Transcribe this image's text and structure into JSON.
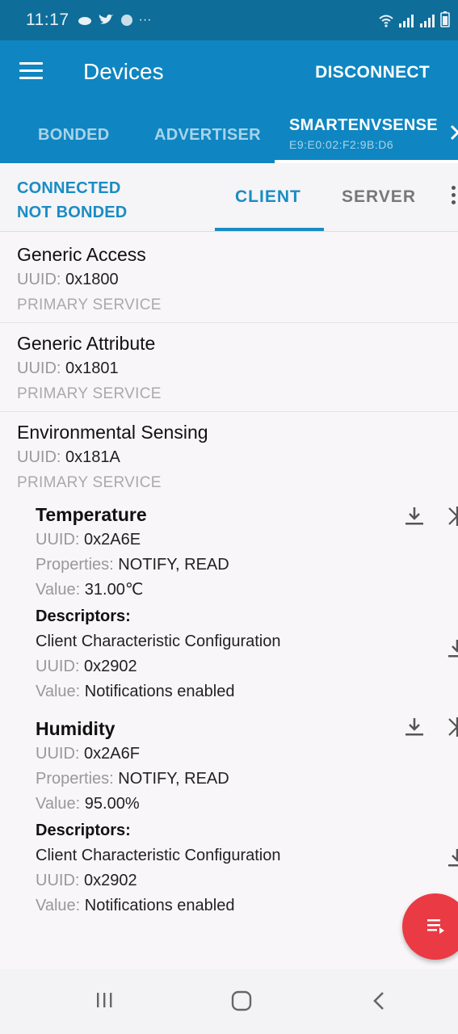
{
  "status_bar": {
    "time": "11:17",
    "more": "···"
  },
  "app_bar": {
    "title": "Devices",
    "action": "DISCONNECT"
  },
  "device_tabs": [
    {
      "label": "BONDED"
    },
    {
      "label": "ADVERTISER"
    },
    {
      "label": "SMARTENVSENSE",
      "address": "E9:E0:02:F2:9B:D6"
    }
  ],
  "connection": {
    "state": "CONNECTED",
    "bond": "NOT BONDED",
    "tabs": [
      "CLIENT",
      "SERVER"
    ]
  },
  "labels": {
    "uuid": "UUID:",
    "properties": "Properties:",
    "value": "Value:",
    "descriptors": "Descriptors:"
  },
  "services": [
    {
      "name": "Generic Access",
      "uuid": "0x1800",
      "type": "PRIMARY SERVICE"
    },
    {
      "name": "Generic Attribute",
      "uuid": "0x1801",
      "type": "PRIMARY SERVICE"
    },
    {
      "name": "Environmental Sensing",
      "uuid": "0x181A",
      "type": "PRIMARY SERVICE",
      "characteristics": [
        {
          "name": "Temperature",
          "uuid": "0x2A6E",
          "properties": "NOTIFY, READ",
          "value": "31.00℃",
          "descriptor": {
            "name": "Client Characteristic Configuration",
            "uuid": "0x2902",
            "value": "Notifications enabled"
          }
        },
        {
          "name": "Humidity",
          "uuid": "0x2A6F",
          "properties": "NOTIFY, READ",
          "value": "95.00%",
          "descriptor": {
            "name": "Client Characteristic Configuration",
            "uuid": "0x2902",
            "value": "Notifications enabled"
          }
        }
      ]
    }
  ],
  "colors": {
    "primary": "#0f86c1",
    "status_bar": "#0e6d99",
    "accent": "#1a8cc4",
    "fab": "#ea3a44"
  }
}
